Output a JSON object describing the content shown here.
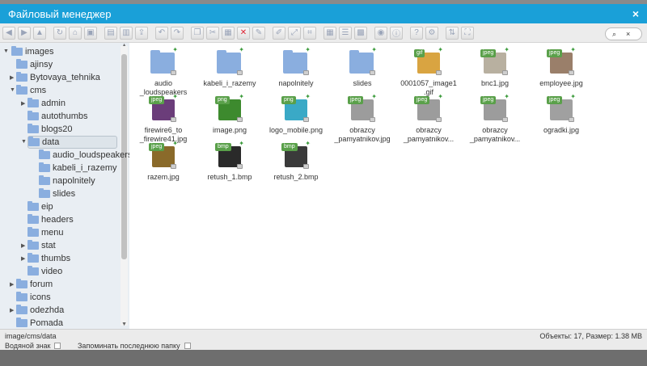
{
  "window": {
    "title": "Файловый менеджер",
    "close": "×"
  },
  "toolbar": {
    "search_icon": "⌕",
    "search_clear": "×",
    "delete_icon": "✕"
  },
  "tree": [
    {
      "label": "images",
      "expanded": true
    },
    {
      "label": "ajinsy"
    },
    {
      "label": "Bytovaya_tehnika"
    },
    {
      "label": "cms",
      "expanded": true
    },
    {
      "label": "admin"
    },
    {
      "label": "autothumbs"
    },
    {
      "label": "blogs20"
    },
    {
      "label": "data",
      "expanded": true,
      "selected": true
    },
    {
      "label": "audio_loudspeakers"
    },
    {
      "label": "kabeli_i_razemy"
    },
    {
      "label": "napolnitely"
    },
    {
      "label": "slides"
    },
    {
      "label": "eip"
    },
    {
      "label": "headers"
    },
    {
      "label": "menu"
    },
    {
      "label": "stat"
    },
    {
      "label": "thumbs"
    },
    {
      "label": "video"
    },
    {
      "label": "forum"
    },
    {
      "label": "icons"
    },
    {
      "label": "odezhda"
    },
    {
      "label": "Pomada"
    }
  ],
  "files": [
    {
      "name": "audio\n_loudspeakers",
      "kind": "folder"
    },
    {
      "name": "kabeli_i_razemy",
      "kind": "folder"
    },
    {
      "name": "napolnitely",
      "kind": "folder"
    },
    {
      "name": "slides",
      "kind": "folder"
    },
    {
      "name": "0001057_image1\n.gif",
      "kind": "file",
      "badge": "gif",
      "color": "#d9a441"
    },
    {
      "name": "bnc1.jpg",
      "kind": "file",
      "badge": "jpeg",
      "color": "#b8b0a0"
    },
    {
      "name": "employee.jpg",
      "kind": "file",
      "badge": "jpeg",
      "color": "#9a7f6a"
    },
    {
      "name": "firewire6_to\n_firewire41.jpg",
      "kind": "file",
      "badge": "jpeg",
      "color": "#6b3d7a"
    },
    {
      "name": "image.png",
      "kind": "file",
      "badge": "png",
      "color": "#3d8a2e"
    },
    {
      "name": "logo_mobile.png",
      "kind": "file",
      "badge": "png",
      "color": "#3aa9c6"
    },
    {
      "name": "obrazcy\n_pamyatnikov.jpg",
      "kind": "file",
      "badge": "jpeg",
      "color": "#9c9c9c"
    },
    {
      "name": "obrazcy\n_pamyatnikov...",
      "kind": "file",
      "badge": "jpeg",
      "color": "#9c9c9c"
    },
    {
      "name": "obrazcy\n_pamyatnikov...",
      "kind": "file",
      "badge": "jpeg",
      "color": "#9c9c9c"
    },
    {
      "name": "ogradki.jpg",
      "kind": "file",
      "badge": "jpeg",
      "color": "#a0a0a0"
    },
    {
      "name": "razem.jpg",
      "kind": "file",
      "badge": "jpeg",
      "color": "#8a6a2a"
    },
    {
      "name": "retush_1.bmp",
      "kind": "file",
      "badge": "bmp",
      "color": "#2a2a2a"
    },
    {
      "name": "retush_2.bmp",
      "kind": "file",
      "badge": "bmp",
      "color": "#3a3a3a"
    }
  ],
  "status": {
    "path": "image/cms/data",
    "info": "Объекты: 17, Размер: 1.38 MB",
    "watermark_label": "Водяной знак",
    "remember_label": "Запоминать последнюю папку"
  },
  "colors": {
    "accent": "#1aa0d8",
    "folder": "#8aaedf",
    "badge": "#5aa04a"
  }
}
